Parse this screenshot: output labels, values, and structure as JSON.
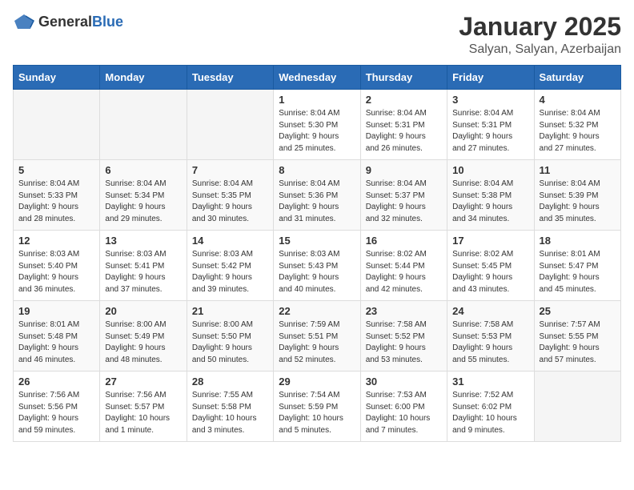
{
  "logo": {
    "general": "General",
    "blue": "Blue"
  },
  "header": {
    "month": "January 2025",
    "location": "Salyan, Salyan, Azerbaijan"
  },
  "days_of_week": [
    "Sunday",
    "Monday",
    "Tuesday",
    "Wednesday",
    "Thursday",
    "Friday",
    "Saturday"
  ],
  "weeks": [
    [
      {
        "day": "",
        "info": ""
      },
      {
        "day": "",
        "info": ""
      },
      {
        "day": "",
        "info": ""
      },
      {
        "day": "1",
        "info": "Sunrise: 8:04 AM\nSunset: 5:30 PM\nDaylight: 9 hours\nand 25 minutes."
      },
      {
        "day": "2",
        "info": "Sunrise: 8:04 AM\nSunset: 5:31 PM\nDaylight: 9 hours\nand 26 minutes."
      },
      {
        "day": "3",
        "info": "Sunrise: 8:04 AM\nSunset: 5:31 PM\nDaylight: 9 hours\nand 27 minutes."
      },
      {
        "day": "4",
        "info": "Sunrise: 8:04 AM\nSunset: 5:32 PM\nDaylight: 9 hours\nand 27 minutes."
      }
    ],
    [
      {
        "day": "5",
        "info": "Sunrise: 8:04 AM\nSunset: 5:33 PM\nDaylight: 9 hours\nand 28 minutes."
      },
      {
        "day": "6",
        "info": "Sunrise: 8:04 AM\nSunset: 5:34 PM\nDaylight: 9 hours\nand 29 minutes."
      },
      {
        "day": "7",
        "info": "Sunrise: 8:04 AM\nSunset: 5:35 PM\nDaylight: 9 hours\nand 30 minutes."
      },
      {
        "day": "8",
        "info": "Sunrise: 8:04 AM\nSunset: 5:36 PM\nDaylight: 9 hours\nand 31 minutes."
      },
      {
        "day": "9",
        "info": "Sunrise: 8:04 AM\nSunset: 5:37 PM\nDaylight: 9 hours\nand 32 minutes."
      },
      {
        "day": "10",
        "info": "Sunrise: 8:04 AM\nSunset: 5:38 PM\nDaylight: 9 hours\nand 34 minutes."
      },
      {
        "day": "11",
        "info": "Sunrise: 8:04 AM\nSunset: 5:39 PM\nDaylight: 9 hours\nand 35 minutes."
      }
    ],
    [
      {
        "day": "12",
        "info": "Sunrise: 8:03 AM\nSunset: 5:40 PM\nDaylight: 9 hours\nand 36 minutes."
      },
      {
        "day": "13",
        "info": "Sunrise: 8:03 AM\nSunset: 5:41 PM\nDaylight: 9 hours\nand 37 minutes."
      },
      {
        "day": "14",
        "info": "Sunrise: 8:03 AM\nSunset: 5:42 PM\nDaylight: 9 hours\nand 39 minutes."
      },
      {
        "day": "15",
        "info": "Sunrise: 8:03 AM\nSunset: 5:43 PM\nDaylight: 9 hours\nand 40 minutes."
      },
      {
        "day": "16",
        "info": "Sunrise: 8:02 AM\nSunset: 5:44 PM\nDaylight: 9 hours\nand 42 minutes."
      },
      {
        "day": "17",
        "info": "Sunrise: 8:02 AM\nSunset: 5:45 PM\nDaylight: 9 hours\nand 43 minutes."
      },
      {
        "day": "18",
        "info": "Sunrise: 8:01 AM\nSunset: 5:47 PM\nDaylight: 9 hours\nand 45 minutes."
      }
    ],
    [
      {
        "day": "19",
        "info": "Sunrise: 8:01 AM\nSunset: 5:48 PM\nDaylight: 9 hours\nand 46 minutes."
      },
      {
        "day": "20",
        "info": "Sunrise: 8:00 AM\nSunset: 5:49 PM\nDaylight: 9 hours\nand 48 minutes."
      },
      {
        "day": "21",
        "info": "Sunrise: 8:00 AM\nSunset: 5:50 PM\nDaylight: 9 hours\nand 50 minutes."
      },
      {
        "day": "22",
        "info": "Sunrise: 7:59 AM\nSunset: 5:51 PM\nDaylight: 9 hours\nand 52 minutes."
      },
      {
        "day": "23",
        "info": "Sunrise: 7:58 AM\nSunset: 5:52 PM\nDaylight: 9 hours\nand 53 minutes."
      },
      {
        "day": "24",
        "info": "Sunrise: 7:58 AM\nSunset: 5:53 PM\nDaylight: 9 hours\nand 55 minutes."
      },
      {
        "day": "25",
        "info": "Sunrise: 7:57 AM\nSunset: 5:55 PM\nDaylight: 9 hours\nand 57 minutes."
      }
    ],
    [
      {
        "day": "26",
        "info": "Sunrise: 7:56 AM\nSunset: 5:56 PM\nDaylight: 9 hours\nand 59 minutes."
      },
      {
        "day": "27",
        "info": "Sunrise: 7:56 AM\nSunset: 5:57 PM\nDaylight: 10 hours\nand 1 minute."
      },
      {
        "day": "28",
        "info": "Sunrise: 7:55 AM\nSunset: 5:58 PM\nDaylight: 10 hours\nand 3 minutes."
      },
      {
        "day": "29",
        "info": "Sunrise: 7:54 AM\nSunset: 5:59 PM\nDaylight: 10 hours\nand 5 minutes."
      },
      {
        "day": "30",
        "info": "Sunrise: 7:53 AM\nSunset: 6:00 PM\nDaylight: 10 hours\nand 7 minutes."
      },
      {
        "day": "31",
        "info": "Sunrise: 7:52 AM\nSunset: 6:02 PM\nDaylight: 10 hours\nand 9 minutes."
      },
      {
        "day": "",
        "info": ""
      }
    ]
  ]
}
